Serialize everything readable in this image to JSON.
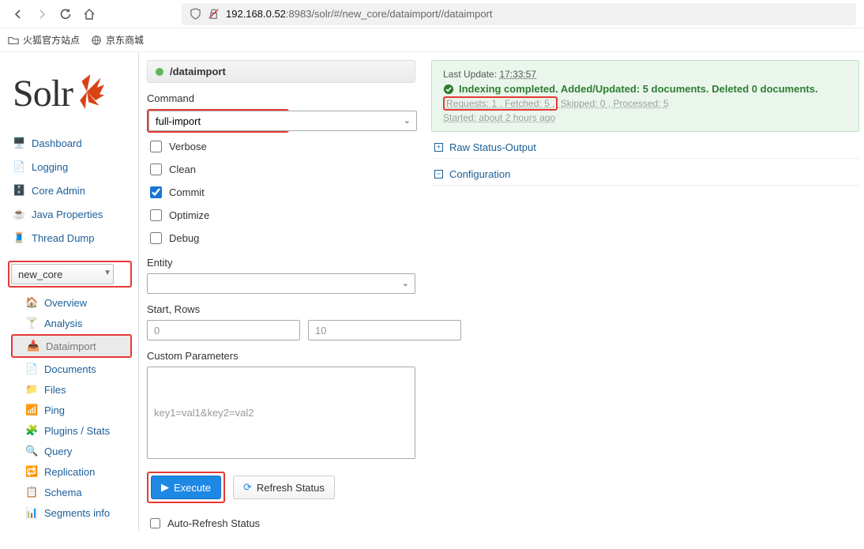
{
  "browser": {
    "url_prefix": "192.168.0.52",
    "url_rest": ":8983/solr/#/new_core/dataimport//dataimport",
    "bookmarks": {
      "b1": "火狐官方站点",
      "b2": "京东商城"
    }
  },
  "logo_text": "Solr",
  "nav": {
    "dashboard": "Dashboard",
    "logging": "Logging",
    "coreadmin": "Core Admin",
    "javaprops": "Java Properties",
    "threaddump": "Thread Dump"
  },
  "core_selected": "new_core",
  "subnav": {
    "overview": "Overview",
    "analysis": "Analysis",
    "dataimport": "Dataimport",
    "documents": "Documents",
    "files": "Files",
    "ping": "Ping",
    "plugins": "Plugins / Stats",
    "query": "Query",
    "replication": "Replication",
    "schema": "Schema",
    "segments": "Segments info"
  },
  "form": {
    "path_title": "/dataimport",
    "command_label": "Command",
    "command_value": "full-import",
    "opt_verbose": "Verbose",
    "opt_clean": "Clean",
    "opt_commit": "Commit",
    "opt_optimize": "Optimize",
    "opt_debug": "Debug",
    "entity_label": "Entity",
    "startrows_label": "Start, Rows",
    "start_ph": "0",
    "rows_ph": "10",
    "custom_label": "Custom Parameters",
    "custom_ph": "key1=val1&key2=val2",
    "execute": "Execute",
    "refresh": "Refresh Status",
    "auto": "Auto-Refresh Status"
  },
  "status": {
    "last_update_label": "Last Update: ",
    "last_update_time": "17:33:57",
    "main": "Indexing completed. Added/Updated: 5 documents. Deleted 0 documents.",
    "req_fetched": "Requests: 1 , Fetched: 5 ,",
    "skipped_proc": " Skipped: 0 , Processed: 5",
    "started": "Started: about 2 hours ago",
    "raw_status": "Raw Status-Output",
    "config": "Configuration"
  }
}
